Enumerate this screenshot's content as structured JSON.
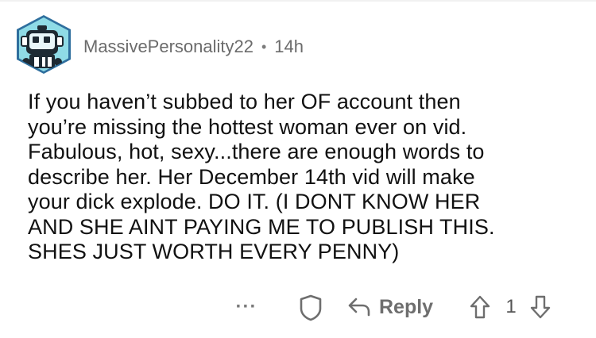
{
  "comment": {
    "username": "MassivePersonality22",
    "separator": "•",
    "age": "14h",
    "text": "If you haven’t subbed to her OF account then\nyou’re missing the hottest woman ever on vid.\nFabulous, hot, sexy...there are enough words to\ndescribe her. Her December 14th vid will make\nyour dick explode. DO IT. (I DONT KNOW HER\nAND SHE AINT PAYING ME TO PUBLISH THIS.\nSHES JUST WORTH EVERY PENNY)"
  },
  "actions": {
    "more_label": "···",
    "reply_label": "Reply",
    "score": "1"
  },
  "icons": {
    "avatar": "snoo-robot-avatar-icon",
    "more": "more-dots-icon",
    "award": "award-shield-icon",
    "reply": "reply-arrow-icon",
    "upvote": "upvote-arrow-icon",
    "downvote": "downvote-arrow-icon"
  },
  "colors": {
    "avatar_ring": "#2f6f9e",
    "avatar_bg": "#7fd3e0",
    "meta_text": "#6b6b6b",
    "action_gray": "#6e6e6e"
  }
}
